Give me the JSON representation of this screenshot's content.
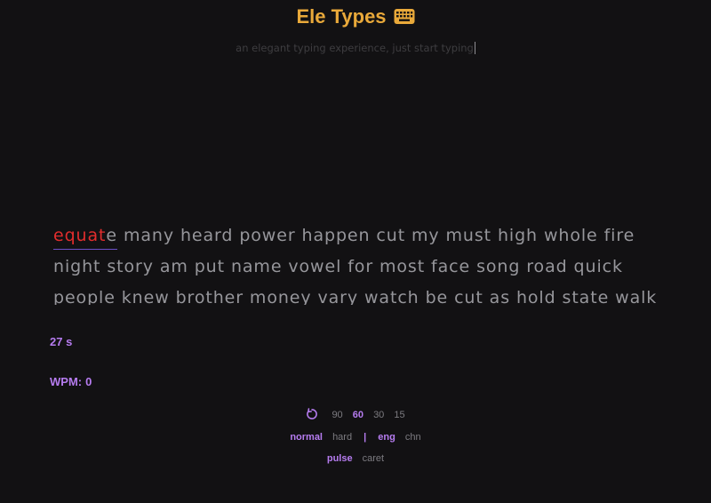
{
  "header": {
    "title": "Ele Types",
    "title_icon": "keyboard-icon",
    "tagline": "an elegant typing experience, just start typing"
  },
  "typing": {
    "current_word": {
      "typed_wrong": "equat",
      "remaining": "e"
    },
    "words": [
      "many",
      "heard",
      "power",
      "happen",
      "cut",
      "my",
      "must",
      "high",
      "whole",
      "fire",
      "night",
      "story",
      "am",
      "put",
      "name",
      "vowel",
      "for",
      "most",
      "face",
      "song",
      "road",
      "quick",
      "people",
      "knew",
      "brother",
      "money",
      "vary",
      "watch",
      "be",
      "cut",
      "as",
      "hold",
      "state",
      "walk"
    ]
  },
  "stats": {
    "timer": "27 s",
    "wpm_label": "WPM:",
    "wpm_value": "0"
  },
  "controls": {
    "restart_icon": "restart-icon",
    "durations": [
      "90",
      "60",
      "30",
      "15"
    ],
    "active_duration": "60",
    "difficulty": [
      "normal",
      "hard"
    ],
    "active_difficulty": "normal",
    "separator": "|",
    "languages": [
      "eng",
      "chn"
    ],
    "active_language": "eng",
    "caret_styles": [
      "pulse",
      "caret"
    ],
    "active_caret_style": "pulse"
  },
  "colors": {
    "background": "#121113",
    "accent_title": "#e9a93a",
    "accent_purple": "#b67cf0",
    "error_red": "#e12d2d",
    "word_gray": "#96969b"
  }
}
